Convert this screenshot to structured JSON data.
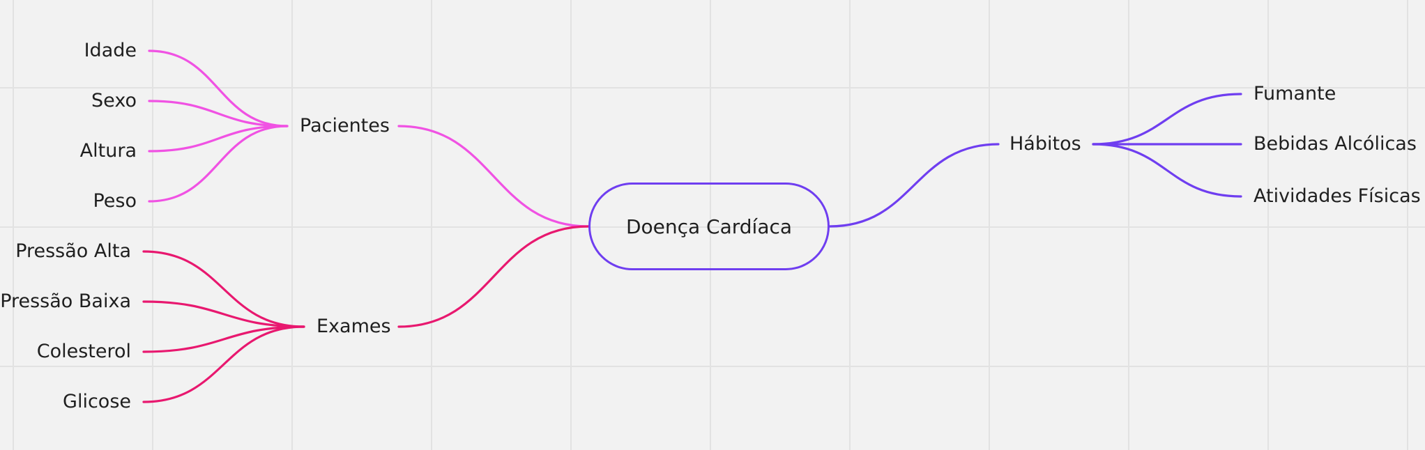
{
  "colors": {
    "background": "#f2f2f2",
    "grid": "#e2e2e2",
    "pink": "#f052e3",
    "magenta": "#e8186f",
    "purple": "#6f3ef0",
    "text": "#1f1f1f"
  },
  "mindmap": {
    "root": "Doença Cardíaca",
    "branches": [
      {
        "id": "pacientes",
        "label": "Pacientes",
        "color": "#f052e3",
        "children": [
          "Idade",
          "Sexo",
          "Altura",
          "Peso"
        ]
      },
      {
        "id": "exames",
        "label": "Exames",
        "color": "#e8186f",
        "children": [
          "Pressão Alta",
          "Pressão Baixa",
          "Colesterol",
          "Glicose"
        ]
      },
      {
        "id": "habitos",
        "label": "Hábitos",
        "color": "#6f3ef0",
        "children": [
          "Fumante",
          "Bebidas Alcólicas",
          "Atividades Físicas"
        ]
      }
    ]
  }
}
